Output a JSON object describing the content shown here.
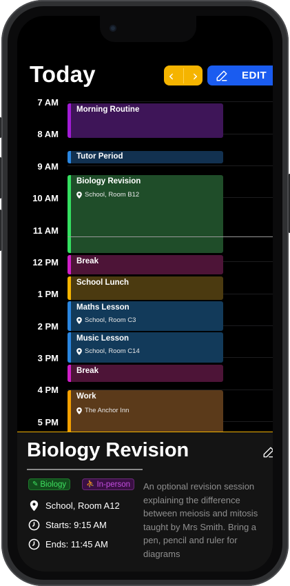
{
  "header": {
    "title": "Today",
    "prev_icon": "chevron-left-icon",
    "next_icon": "chevron-right-icon",
    "edit_label": "EDIT"
  },
  "time_labels": [
    "7 AM",
    "8 AM",
    "9 AM",
    "10 AM",
    "11 AM",
    "12 PM",
    "1 PM",
    "2 PM",
    "3 PM",
    "4 PM",
    "5 PM"
  ],
  "events": [
    {
      "name": "Morning Routine",
      "location": "",
      "bar_color": "#a21cd6",
      "bg_color": "#3e1558"
    },
    {
      "name": "Tutor Period",
      "location": "",
      "bar_color": "#2a86e0",
      "bg_color": "#123150"
    },
    {
      "name": "Biology Revision",
      "location": "School, Room B12",
      "bar_color": "#34e060",
      "bg_color": "#1f4d29"
    },
    {
      "name": "Break",
      "location": "",
      "bar_color": "#d01fc8",
      "bg_color": "#4d1437"
    },
    {
      "name": "School Lunch",
      "location": "",
      "bar_color": "#f5b400",
      "bg_color": "#4b3a10"
    },
    {
      "name": "Maths Lesson",
      "location": "School, Room C3",
      "bar_color": "#2a86e0",
      "bg_color": "#123a5a"
    },
    {
      "name": "Music Lesson",
      "location": "School, Room C14",
      "bar_color": "#2a86e0",
      "bg_color": "#123a5a"
    },
    {
      "name": "Break",
      "location": "",
      "bar_color": "#d01fc8",
      "bg_color": "#4d1437"
    },
    {
      "name": "Work",
      "location": "The Anchor Inn",
      "bar_color": "#f5a000",
      "bg_color": "#5b3a1a"
    }
  ],
  "detail": {
    "title": "Biology Revision",
    "tag_subject": "Biology",
    "tag_mode": "In-person",
    "location": "School, Room A12",
    "starts": "Starts: 9:15 AM",
    "ends": "Ends: 11:45 AM",
    "description": "An optional revision session explaining the difference between meiosis and mitosis taught by Mrs Smith. Bring a pen, pencil and ruler for diagrams"
  },
  "colors": {
    "accent_yellow": "#f5b400",
    "accent_blue": "#1a5cf0",
    "background": "#000000"
  }
}
